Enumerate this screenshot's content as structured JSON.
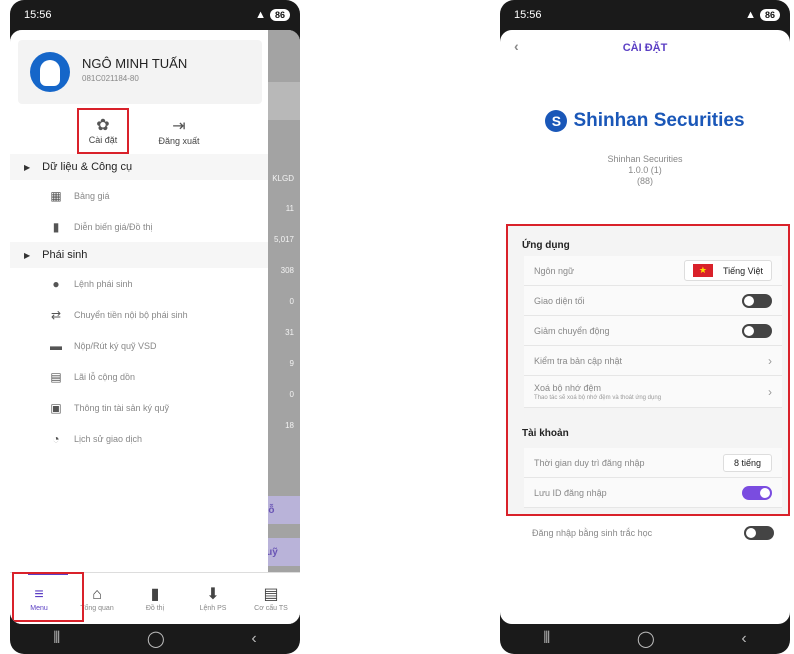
{
  "status_bar": {
    "time": "15:56",
    "battery": "86"
  },
  "left": {
    "profile": {
      "name": "NGÔ MINH TUẤN",
      "account_id": "081C021184-80"
    },
    "quick_actions": {
      "settings": {
        "label": "Cài đặt",
        "icon": "gear-icon"
      },
      "logout": {
        "label": "Đăng xuất",
        "icon": "logout-icon"
      }
    },
    "sections": [
      {
        "title": "Dữ liệu & Công cụ",
        "items": [
          {
            "label": "Bảng giá",
            "icon": "price-board-icon"
          },
          {
            "label": "Diễn biến giá/Đồ thị",
            "icon": "bar-chart-icon"
          }
        ]
      },
      {
        "title": "Phái sinh",
        "items": [
          {
            "label": "Lệnh phái sinh",
            "icon": "order-icon"
          },
          {
            "label": "Chuyển tiền nội bộ phái sinh",
            "icon": "transfer-icon"
          },
          {
            "label": "Nộp/Rút ký quỹ VSD",
            "icon": "deposit-icon"
          },
          {
            "label": "Lãi lỗ cộng dồn",
            "icon": "profit-loss-icon"
          },
          {
            "label": "Thông tin tài sản ký quỹ",
            "icon": "asset-info-icon"
          },
          {
            "label": "Lịch sử giao dịch",
            "icon": "history-icon"
          }
        ]
      }
    ],
    "background": {
      "column_header": "KLGD",
      "values": [
        "11",
        "5,017",
        "308",
        "0",
        "31",
        "9",
        "0",
        "18"
      ],
      "pill_1": "i/lỗ",
      "pill_2": "quỹ"
    },
    "tabs": [
      {
        "label": "Menu",
        "icon": "menu-icon",
        "active": true
      },
      {
        "label": "Tổng quan",
        "icon": "home-icon",
        "active": false
      },
      {
        "label": "Đồ thị",
        "icon": "chart-icon",
        "active": false
      },
      {
        "label": "Lệnh PS",
        "icon": "order-ps-icon",
        "active": false
      },
      {
        "label": "Cơ cấu TS",
        "icon": "portfolio-icon",
        "active": false
      }
    ]
  },
  "right": {
    "header_title": "CÀI ĐẶT",
    "brand_name": "Shinhan Securities",
    "app_name": "Shinhan Securities",
    "version": "1.0.0 (1)",
    "build": "(88)",
    "groups": {
      "app": {
        "title": "Ứng dụng",
        "language_label": "Ngôn ngữ",
        "language_value": "Tiếng Việt",
        "dark_mode_label": "Giao diện tối",
        "dark_mode_on": false,
        "reduce_motion_label": "Giảm chuyển động",
        "reduce_motion_on": false,
        "check_update_label": "Kiểm tra bản cập nhật",
        "clear_cache_label": "Xoá bộ nhớ đệm",
        "clear_cache_sub": "Thao tác sẽ xoá bộ nhớ đệm và thoát ứng dụng"
      },
      "account": {
        "title": "Tài khoản",
        "session_label": "Thời gian duy trì đăng nhập",
        "session_value": "8 tiếng",
        "save_id_label": "Lưu ID đăng nhập",
        "save_id_on": true,
        "biometric_label": "Đăng nhập bằng sinh trắc học",
        "biometric_on": false
      }
    }
  },
  "colors": {
    "accent": "#5b3fc4",
    "highlight": "#d9212a",
    "brand": "#1a57b8"
  }
}
